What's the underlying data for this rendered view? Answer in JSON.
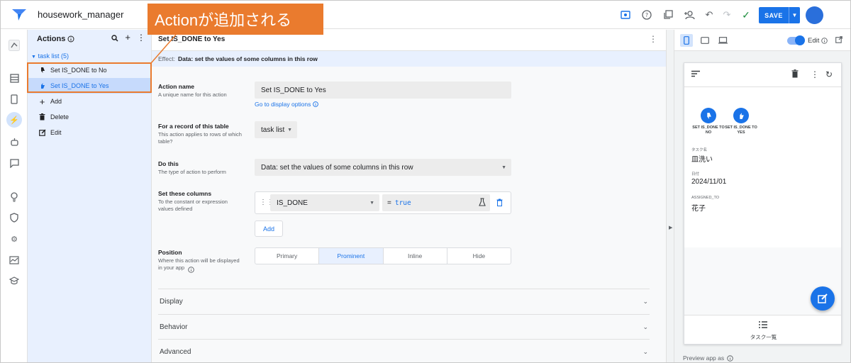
{
  "app": {
    "title": "housework_manager"
  },
  "callout": {
    "text": "Actionが追加される"
  },
  "toolbar": {
    "save_label": "SAVE"
  },
  "actions_panel": {
    "title": "Actions",
    "group_label": "task list (5)",
    "items": [
      {
        "label": "Set IS_DONE to No"
      },
      {
        "label": "Set IS_DONE to Yes"
      }
    ],
    "commands": [
      {
        "label": "Add"
      },
      {
        "label": "Delete"
      },
      {
        "label": "Edit"
      }
    ]
  },
  "editor": {
    "title": "Set IS_DONE to Yes",
    "effect_prefix": "Effect:",
    "effect_value": "Data: set the values of some columns in this row",
    "action_name": {
      "label": "Action name",
      "desc": "A unique name for this action",
      "value": "Set IS_DONE to Yes",
      "link": "Go to display options"
    },
    "record_table": {
      "label": "For a record of this table",
      "desc": "This action applies to rows of which table?",
      "value": "task list"
    },
    "do_this": {
      "label": "Do this",
      "desc": "The type of action to perform",
      "value": "Data: set the values of some columns in this row"
    },
    "set_columns": {
      "label": "Set these columns",
      "desc": "To the constant or expression values defined",
      "column": "IS_DONE",
      "eq": "=",
      "expression": "true",
      "add_label": "Add"
    },
    "position": {
      "label": "Position",
      "desc": "Where this action will be displayed in your app",
      "options": [
        "Primary",
        "Prominent",
        "Inline",
        "Hide"
      ],
      "selected": "Prominent"
    },
    "sections": [
      "Display",
      "Behavior",
      "Advanced"
    ]
  },
  "preview": {
    "edit_label": "Edit",
    "foot_label": "Preview app as",
    "actions": [
      {
        "label": "SET IS_DONE TO NO"
      },
      {
        "label": "SET IS_DONE TO YES"
      }
    ],
    "fields": [
      {
        "label": "タスク名",
        "value": "皿洗い"
      },
      {
        "label": "日付",
        "value": "2024/11/01"
      },
      {
        "label": "ASSIGNED_TO",
        "value": "花子"
      }
    ],
    "nav_label": "タスク一覧"
  },
  "colors": {
    "accent": "#1a73e8",
    "callout": "#ea7b2e"
  }
}
